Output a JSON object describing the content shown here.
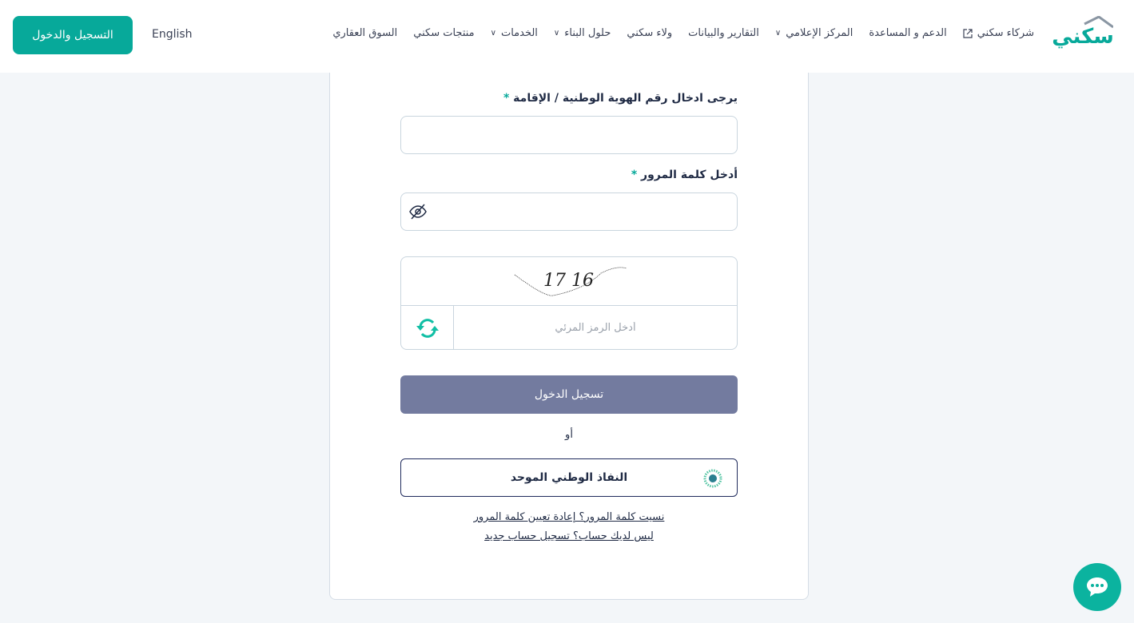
{
  "header": {
    "logo_text": "سكني",
    "nav": [
      {
        "label": "السوق العقاري",
        "dropdown": false
      },
      {
        "label": "منتجات سكني",
        "dropdown": false
      },
      {
        "label": "الخدمات",
        "dropdown": true
      },
      {
        "label": "حلول البناء",
        "dropdown": true
      },
      {
        "label": "ولاء سكني",
        "dropdown": false
      },
      {
        "label": "التقارير والبيانات",
        "dropdown": false
      },
      {
        "label": "المركز الإعلامي",
        "dropdown": true
      },
      {
        "label": "الدعم و المساعدة",
        "dropdown": false
      },
      {
        "label": "شركاء سكني",
        "external": true
      }
    ],
    "language": "English",
    "register_login": "التسجيل والدخول"
  },
  "form": {
    "id_label": "يرجى ادخال رقم الهوية الوطنية / الإقامة",
    "id_value": "",
    "password_label": "أدخل كلمة المرور",
    "password_value": "",
    "required_mark": "*",
    "captcha_text": "17 16",
    "captcha_placeholder": "أدخل الرمز المرئي",
    "login_button": "تسجيل الدخول",
    "or": "أو",
    "nafath_button": "النفاذ الوطني الموحد",
    "forgot_link": "نسيت كلمة المرور؟ إعادة تعيين كلمة المرور",
    "register_link": "ليس لديك حساب؟ تسجيل حساب جديد"
  },
  "colors": {
    "brand": "#07a99a",
    "login_button": "#737b9f",
    "nafath_border": "#1f2a5c"
  }
}
